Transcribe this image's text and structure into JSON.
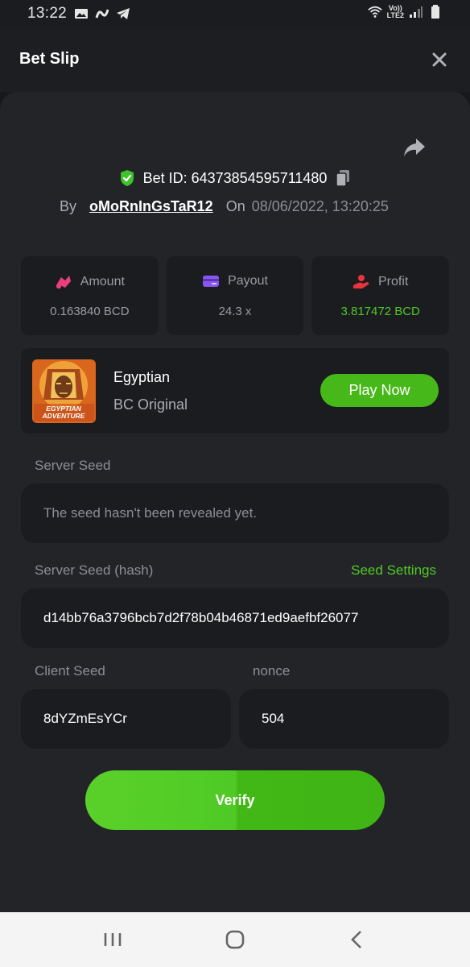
{
  "status": {
    "time": "13:22",
    "lte_top": "Vo))",
    "lte_bottom": "LTE2"
  },
  "header": {
    "title": "Bet Slip"
  },
  "bet": {
    "id_text": "Bet ID: 64373854595711480",
    "by_label": "By",
    "username": "oMoRnInGsTaR12",
    "on_label": "On",
    "date": "08/06/2022, 13:20:25"
  },
  "stats": [
    {
      "label": "Amount",
      "value": "0.163840 BCD",
      "icon": "amount-icon",
      "color": "#e8407a"
    },
    {
      "label": "Payout",
      "value": "24.3 x",
      "icon": "payout-card-icon",
      "color": "#8a56f0"
    },
    {
      "label": "Profit",
      "value": "3.817472 BCD",
      "icon": "profit-hand-icon",
      "color": "#e8343a"
    }
  ],
  "game": {
    "name": "Egyptian",
    "provider": "BC Original",
    "thumb_text_1": "EGYPTIAN",
    "thumb_text_2": "ADVENTURE",
    "play_label": "Play Now"
  },
  "server_seed": {
    "label": "Server Seed",
    "placeholder": "The seed hasn't been revealed yet."
  },
  "server_seed_hash": {
    "label": "Server Seed (hash)",
    "value": "d14bb76a3796bcb7d2f78b04b46871ed9aefbf26077",
    "settings_label": "Seed Settings"
  },
  "client_seed": {
    "label": "Client Seed",
    "value": "8dYZmEsYCr"
  },
  "nonce": {
    "label": "nonce",
    "value": "504"
  },
  "verify_label": "Verify",
  "colors": {
    "accent": "#4fca25",
    "card": "#232428",
    "panel": "#1b1c1f"
  }
}
